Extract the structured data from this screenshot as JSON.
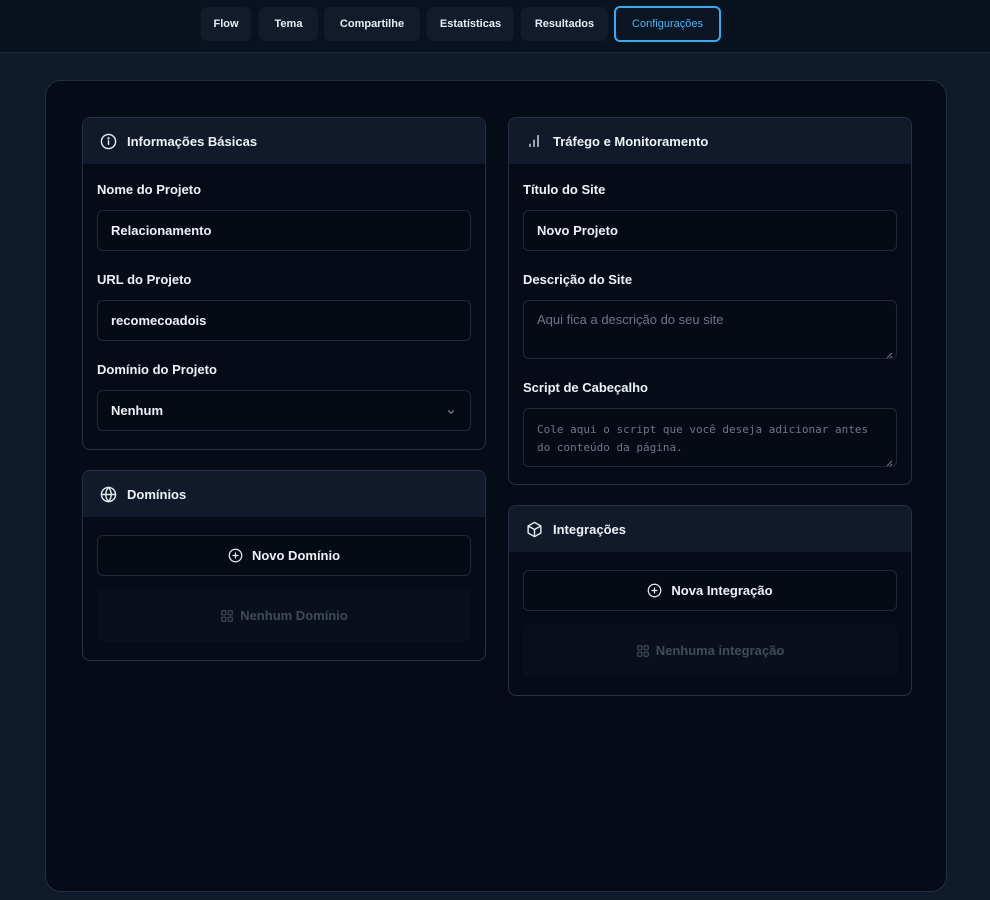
{
  "nav": {
    "tabs": [
      {
        "label": "Flow"
      },
      {
        "label": "Tema"
      },
      {
        "label": "Compartilhe"
      },
      {
        "label": "Estatísticas"
      },
      {
        "label": "Resultados"
      },
      {
        "label": "Configurações",
        "active": true
      }
    ]
  },
  "basic_info": {
    "title": "Informações Básicas",
    "icon": "info-circle-icon",
    "project_name_label": "Nome do Projeto",
    "project_name_value": "Relacionamento",
    "project_url_label": "URL do Projeto",
    "project_url_value": "recomecoadois",
    "project_domain_label": "Domínio do Projeto",
    "project_domain_value": "Nenhum"
  },
  "domains": {
    "title": "Domínios",
    "icon": "globe-icon",
    "add_label": "Novo Domínio",
    "empty_label": "Nenhum Domínio"
  },
  "traffic": {
    "title": "Tráfego e Monitoramento",
    "icon": "bar-chart-icon",
    "site_title_label": "Título do Site",
    "site_title_value": "Novo Projeto",
    "site_description_label": "Descrição do Site",
    "site_description_placeholder": "Aqui fica a descrição do seu site",
    "header_script_label": "Script de Cabeçalho",
    "header_script_placeholder_line1": "Cole aqui o script que você deseja adicionar antes",
    "header_script_placeholder_line2": "do conteúdo da página."
  },
  "integrations": {
    "title": "Integrações",
    "icon": "box-icon",
    "add_label": "Nova Integração",
    "empty_label": "Nenhuma integração"
  },
  "colors": {
    "accent": "#3aa9f0",
    "background": "#0f1a2b",
    "card": "#060c17"
  }
}
